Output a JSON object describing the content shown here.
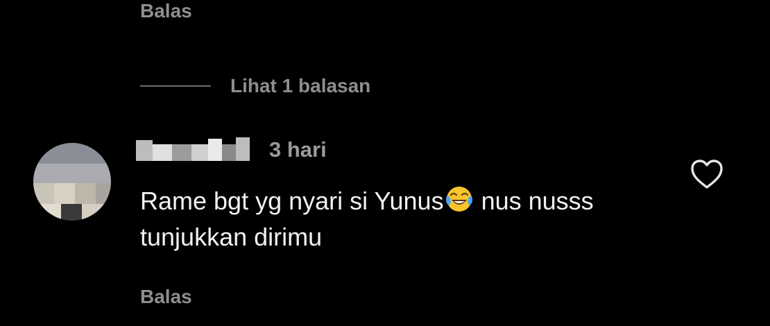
{
  "previous_comment": {
    "reply_label": "Balas"
  },
  "replies_toggle": {
    "label": "Lihat 1 balasan"
  },
  "comment": {
    "username": "",
    "timestamp": "3 hari",
    "text_before_emoji": "Rame bgt yg nyari si Yunus",
    "emoji": "face-with-tears-of-joy-icon",
    "text_after_emoji": " nus nusss tunjukkan dirimu",
    "reply_label": "Balas",
    "like_icon": "heart-outline-icon"
  },
  "colors": {
    "background": "#000000",
    "primary_text": "#f2f2f2",
    "secondary_text": "#8e8e8e"
  }
}
